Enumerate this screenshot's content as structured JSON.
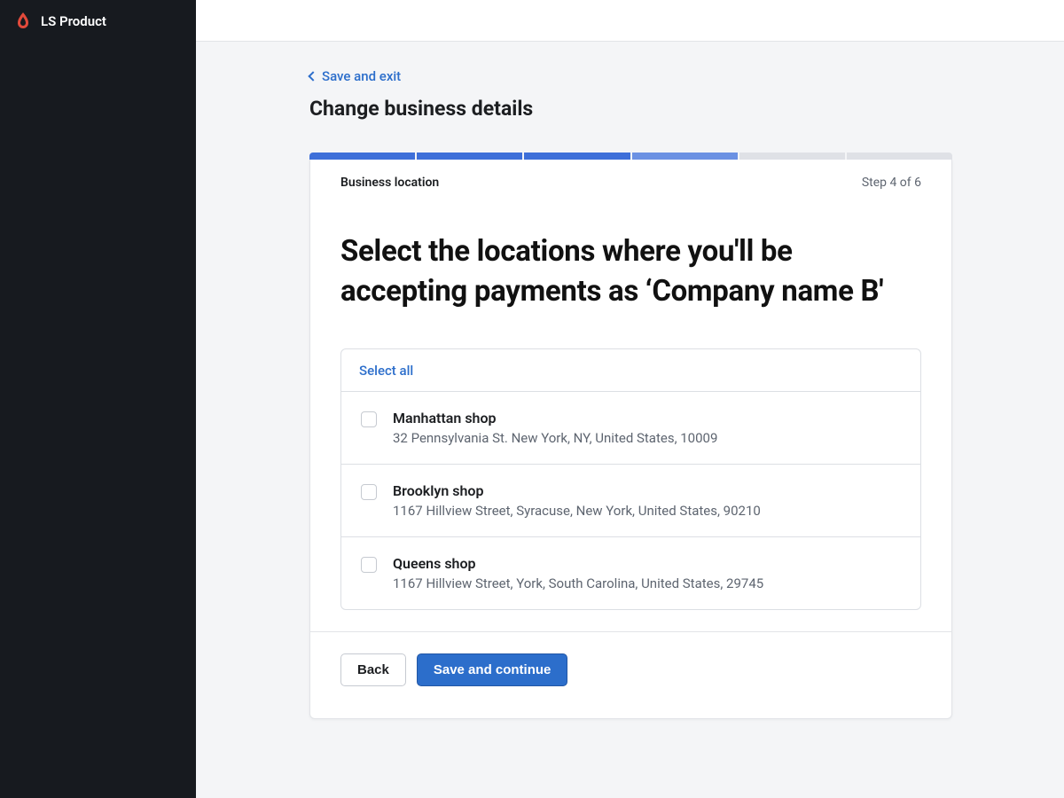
{
  "app_name": "LS Product",
  "breadcrumb": {
    "save_exit_label": "Save and exit"
  },
  "page_title": "Change business details",
  "card": {
    "section_title": "Business location",
    "step_counter": "Step 4 of 6",
    "heading": "Select the locations where you'll be accepting payments as ‘Company name B'",
    "select_all_label": "Select all",
    "locations": [
      {
        "name": "Manhattan shop",
        "address": "32 Pennsylvania St. New York, NY, United States, 10009"
      },
      {
        "name": "Brooklyn shop",
        "address": "1167 Hillview Street, Syracuse, New York, United States, 90210"
      },
      {
        "name": "Queens shop",
        "address": "1167 Hillview Street, York, South Carolina, United States, 29745"
      }
    ]
  },
  "footer": {
    "back_label": "Back",
    "continue_label": "Save and continue"
  },
  "progress": {
    "current_step": 4,
    "total_steps": 6
  }
}
